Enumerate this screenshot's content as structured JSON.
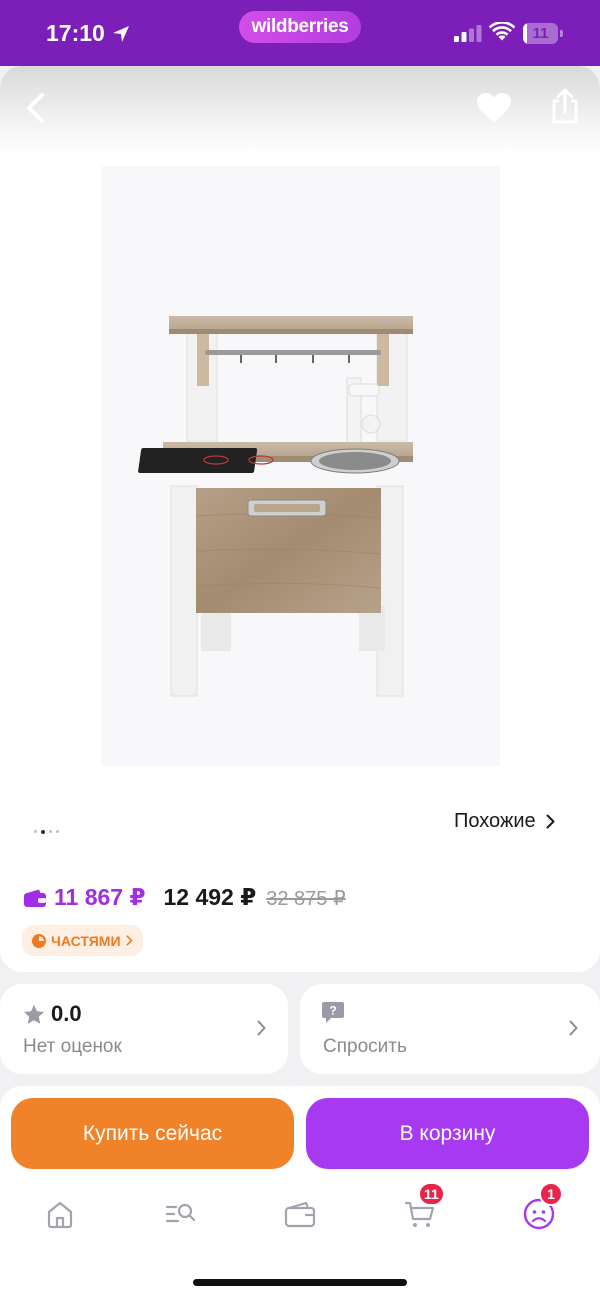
{
  "status_bar": {
    "time": "17:10",
    "brand": "wildberries",
    "battery_level": "11",
    "battery_fraction": 0.11
  },
  "product": {
    "similar_label": "Похожие",
    "image_count": 4,
    "active_image": 2,
    "price_wallet": "11 867 ₽",
    "price": "12 492 ₽",
    "price_old": "32 875 ₽",
    "installment_label": "ЧАСТЯМИ"
  },
  "rating": {
    "value": "0.0",
    "caption": "Нет оценок"
  },
  "ask": {
    "caption": "Спросить"
  },
  "actions": {
    "buy_now": "Купить сейчас",
    "add_to_cart": "В корзину"
  },
  "tabbar": {
    "cart_badge": "11",
    "profile_badge": "1"
  },
  "colors": {
    "brand_purple": "#7b1fb8",
    "wallet_price": "#a12ee3",
    "buy_orange": "#f0822a",
    "cart_purple": "#a73af0",
    "badge_red": "#e8244c"
  },
  "icons": [
    "back-arrow-icon",
    "heart-icon",
    "share-icon",
    "wallet-icon",
    "installment-pie-icon",
    "star-icon",
    "question-bubble-icon",
    "home-icon",
    "catalog-search-icon",
    "wallet-tab-icon",
    "cart-icon",
    "profile-icon"
  ]
}
